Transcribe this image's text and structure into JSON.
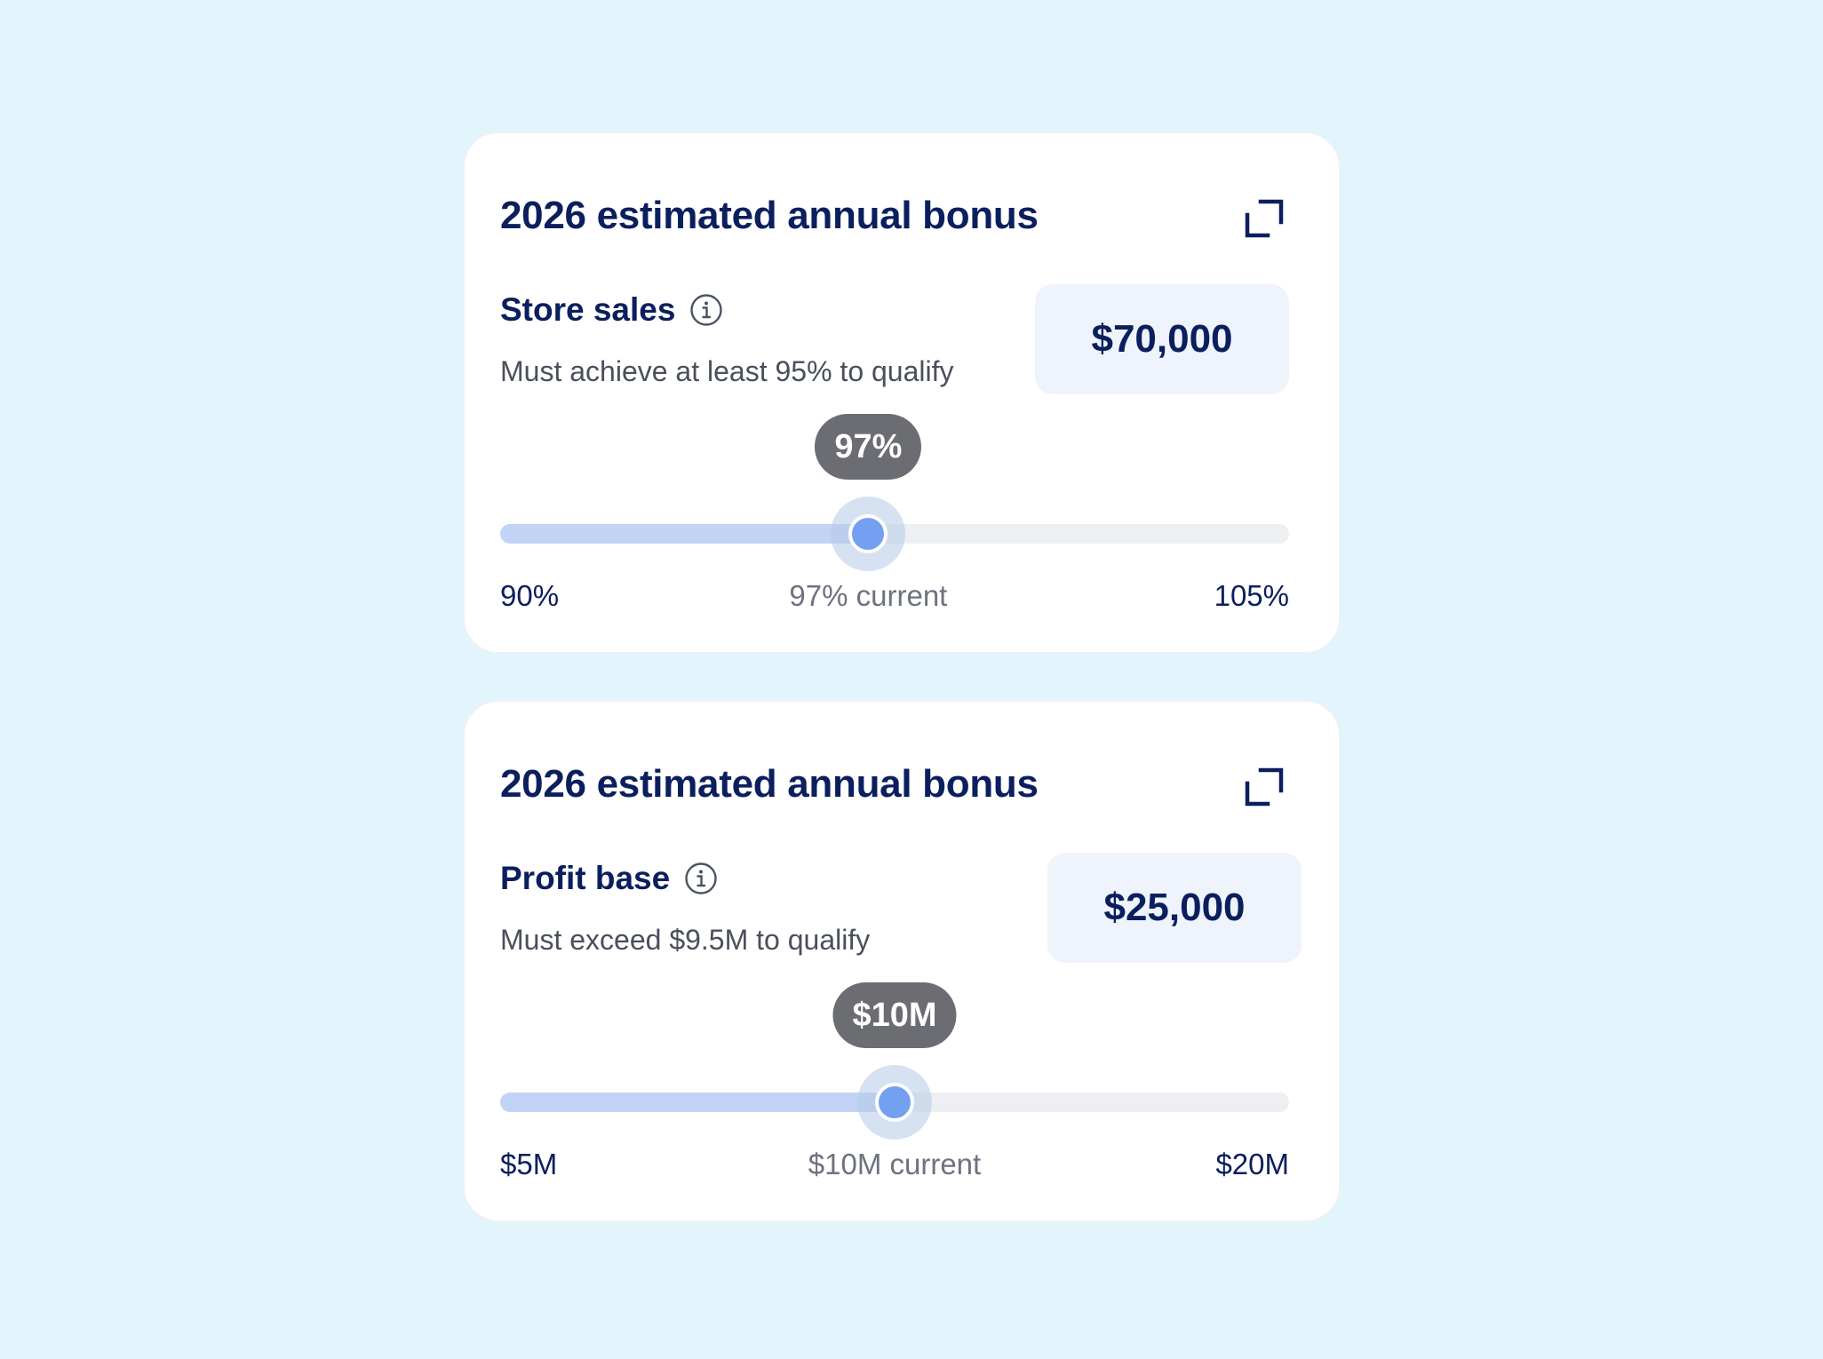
{
  "colors": {
    "background": "#E2F4FC",
    "card": "#FFFFFF",
    "title": "#0B1F5E",
    "amount_bg": "#EEF3FC",
    "track": "#EDEFF3",
    "track_fill": "#C3D3F5",
    "thumb": "#74A0F2",
    "tooltip_bg": "#6B6D72"
  },
  "cards": [
    {
      "title": "2026 estimated annual bonus",
      "expand_icon": "expand-icon",
      "metric": {
        "name": "Store sales",
        "info_icon": "info-icon",
        "description": "Must achieve at least 95% to qualify"
      },
      "amount": "$70,000",
      "slider": {
        "tooltip": "97%",
        "min_label": "90%",
        "max_label": "105%",
        "current_label": "97% current",
        "min": 90,
        "max": 105,
        "value": 97
      }
    },
    {
      "title": "2026 estimated annual bonus",
      "expand_icon": "expand-icon",
      "metric": {
        "name": "Profit base",
        "info_icon": "info-icon",
        "description": "Must exceed $9.5M to qualify"
      },
      "amount": "$25,000",
      "slider": {
        "tooltip": "$10M",
        "min_label": "$5M",
        "max_label": "$20M",
        "current_label": "$10M current",
        "fraction": 0.5
      }
    }
  ]
}
